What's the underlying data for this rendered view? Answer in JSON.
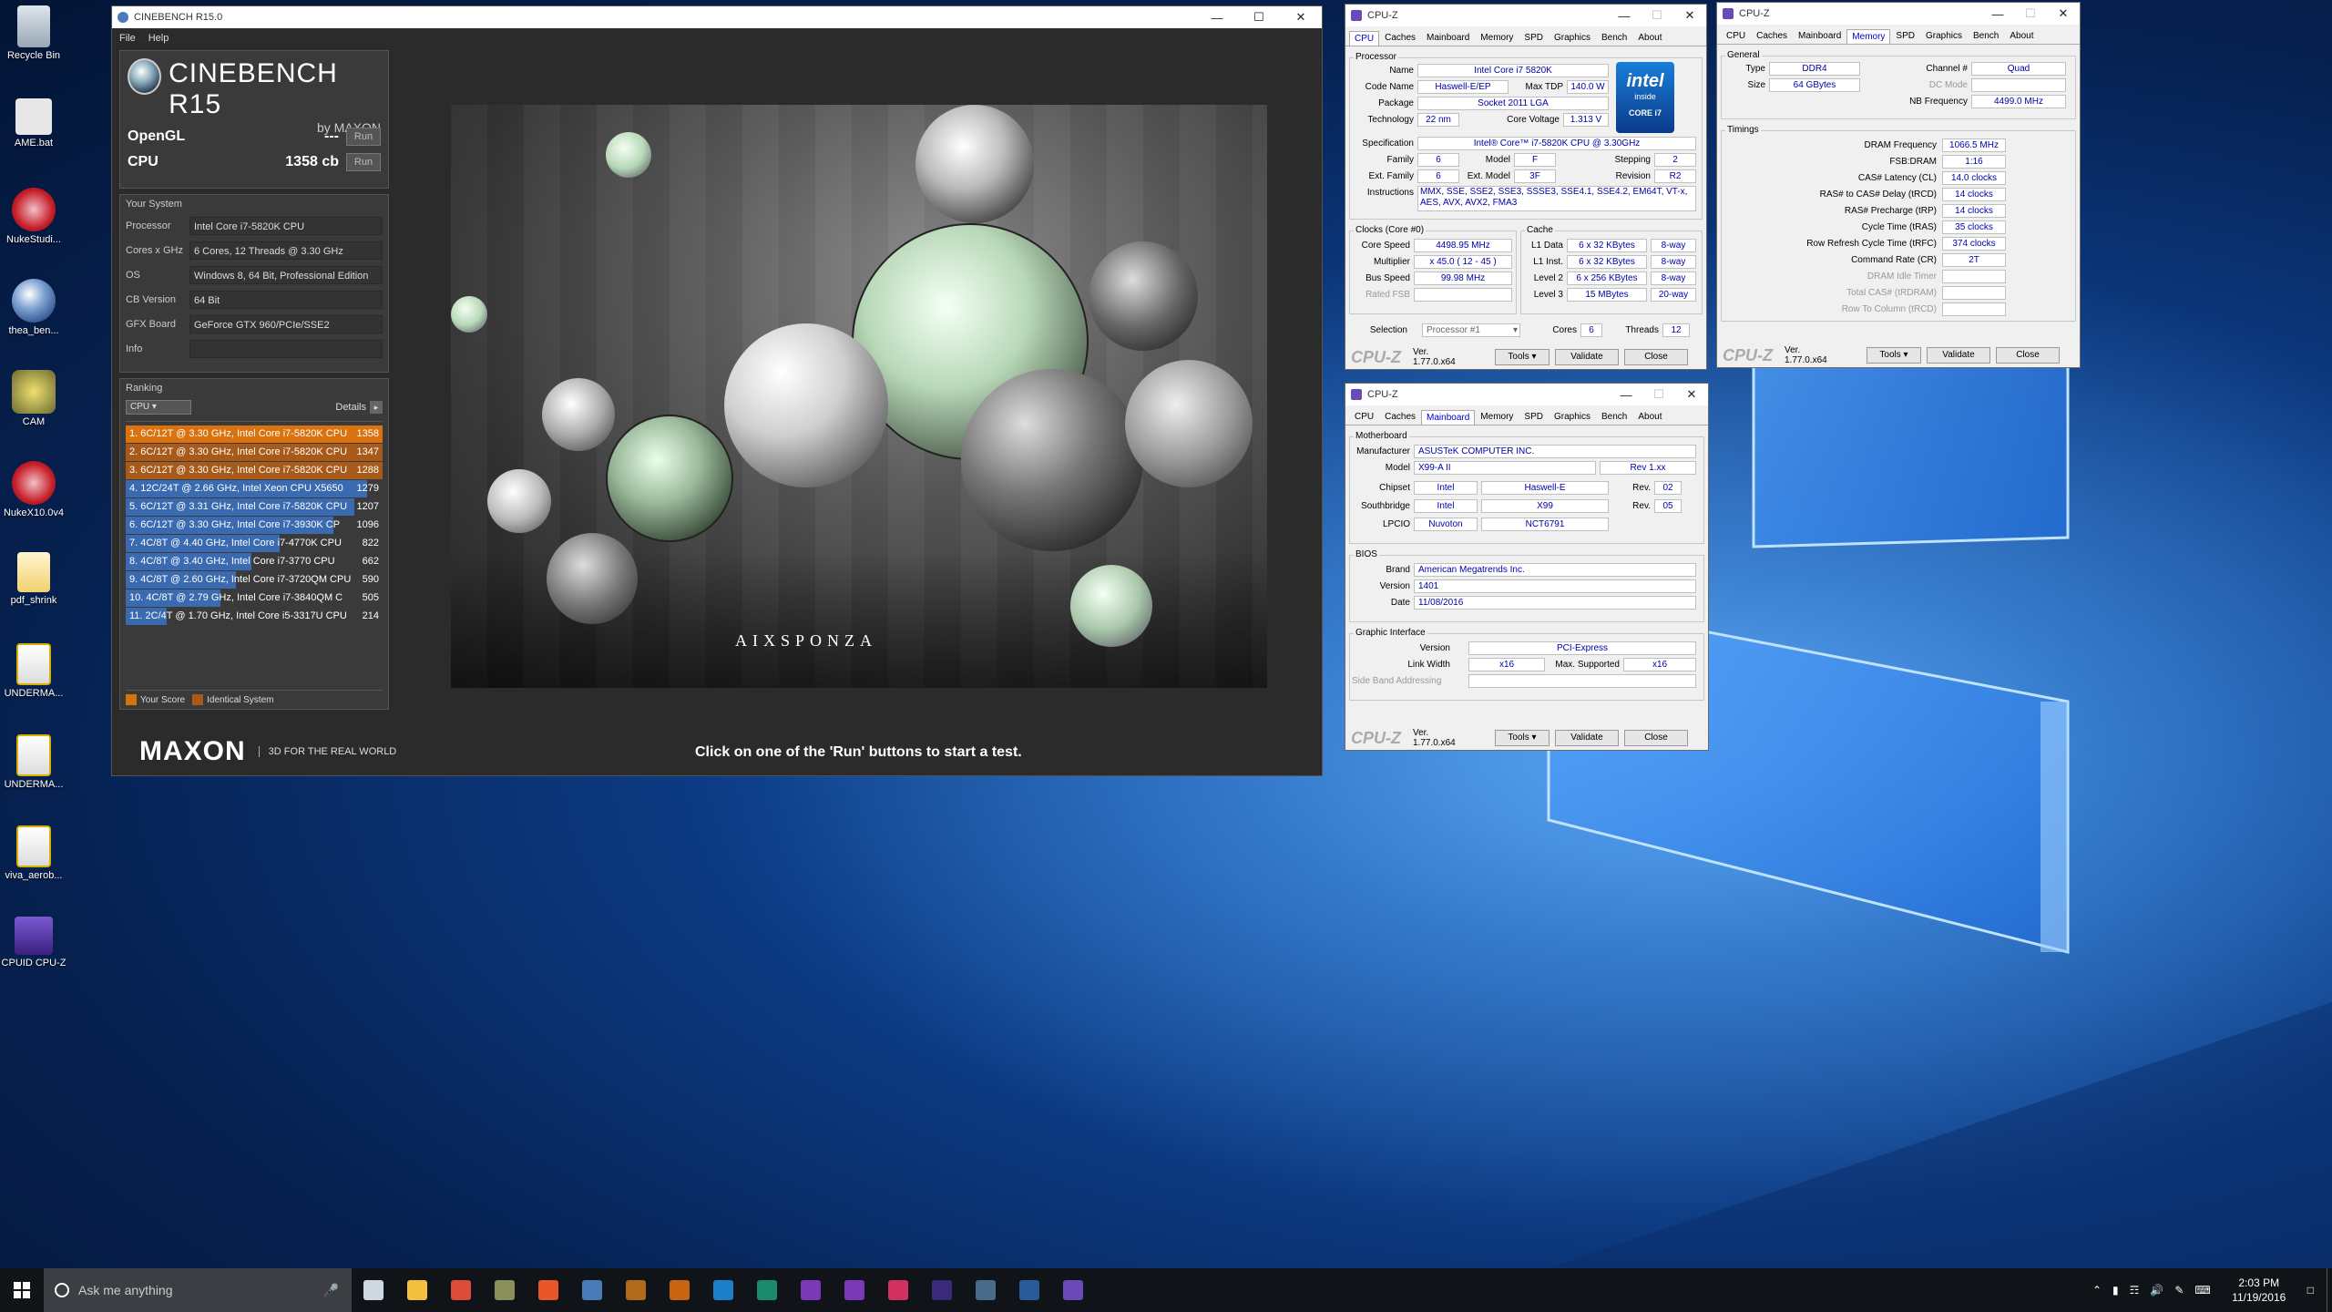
{
  "desktop": {
    "icons": [
      {
        "label": "Recycle Bin",
        "icon": "recycle-bin-icon"
      },
      {
        "label": "AME.bat",
        "icon": "batch-file-icon"
      },
      {
        "label": "NukeStudi...",
        "icon": "nuke-icon"
      },
      {
        "label": "thea_ben...",
        "icon": "cinema4d-icon"
      },
      {
        "label": "CAM",
        "icon": "cam-icon"
      },
      {
        "label": "NukeX10.0v4",
        "icon": "nuke-icon"
      },
      {
        "label": "pdf_shrink",
        "icon": "folder-icon"
      },
      {
        "label": "UNDERMA...",
        "icon": "pdf-icon"
      },
      {
        "label": "UNDERMA...",
        "icon": "pdf-icon"
      },
      {
        "label": "viva_aerob...",
        "icon": "pdf-icon"
      },
      {
        "label": "CPUID CPU-Z",
        "icon": "cpuz-icon"
      }
    ]
  },
  "cinebench": {
    "title": "CINEBENCH R15.0",
    "menu": [
      "File",
      "Help"
    ],
    "logo_title": "CINEBENCH R15",
    "logo_sub": "by MAXON",
    "opengl_label": "OpenGL",
    "opengl_value": "---",
    "cpu_label": "CPU",
    "cpu_value": "1358 cb",
    "run_label": "Run",
    "system_header": "Your System",
    "system": [
      {
        "k": "Processor",
        "v": "Intel Core i7-5820K CPU"
      },
      {
        "k": "Cores x GHz",
        "v": "6 Cores, 12 Threads @ 3.30 GHz"
      },
      {
        "k": "OS",
        "v": "Windows 8, 64 Bit, Professional Edition"
      },
      {
        "k": "CB Version",
        "v": "64 Bit"
      },
      {
        "k": "GFX Board",
        "v": "GeForce GTX 960/PCIe/SSE2"
      },
      {
        "k": "Info",
        "v": ""
      }
    ],
    "ranking_header": "Ranking",
    "ranking_select": "CPU",
    "details_label": "Details",
    "ranking": [
      {
        "label": "1. 6C/12T @ 3.30 GHz, Intel Core i7-5820K CPU",
        "value": "1358",
        "color": "#d9720f",
        "fill": 1.0
      },
      {
        "label": "2. 6C/12T @ 3.30 GHz, Intel Core i7-5820K CPU",
        "value": "1347",
        "color": "#a85a1a",
        "fill": 1.0
      },
      {
        "label": "3. 6C/12T @ 3.30 GHz, Intel Core i7-5820K CPU",
        "value": "1288",
        "color": "#a85a1a",
        "fill": 1.0
      },
      {
        "label": "4. 12C/24T @ 2.66 GHz, Intel Xeon CPU X5650",
        "value": "1279",
        "color": "#3a6ab0",
        "fill": 0.94
      },
      {
        "label": "5. 6C/12T @ 3.31 GHz, Intel Core i7-5820K CPU",
        "value": "1207",
        "color": "#3a6ab0",
        "fill": 0.89
      },
      {
        "label": "6. 6C/12T @ 3.30 GHz, Intel Core i7-3930K CP",
        "value": "1096",
        "color": "#3a6ab0",
        "fill": 0.81
      },
      {
        "label": "7. 4C/8T @ 4.40 GHz, Intel Core i7-4770K CPU",
        "value": "822",
        "color": "#3a6ab0",
        "fill": 0.6
      },
      {
        "label": "8. 4C/8T @ 3.40 GHz, Intel Core i7-3770 CPU",
        "value": "662",
        "color": "#3a6ab0",
        "fill": 0.49
      },
      {
        "label": "9. 4C/8T @ 2.60 GHz, Intel Core i7-3720QM CPU",
        "value": "590",
        "color": "#3a6ab0",
        "fill": 0.43
      },
      {
        "label": "10. 4C/8T @ 2.79 GHz, Intel Core i7-3840QM C",
        "value": "505",
        "color": "#3a6ab0",
        "fill": 0.37
      },
      {
        "label": "11. 2C/4T @ 1.70 GHz, Intel Core i5-3317U CPU",
        "value": "214",
        "color": "#3a6ab0",
        "fill": 0.16
      }
    ],
    "legend_your": "Your Score",
    "legend_identical": "Identical System",
    "footer_brand": "MAXON",
    "footer_tag": "3D FOR THE REAL WORLD",
    "footer_msg": "Click on one of the 'Run' buttons to start a test.",
    "render_credit": "AIXSPONZA"
  },
  "cpuz_common": {
    "title": "CPU-Z",
    "tabs": [
      "CPU",
      "Caches",
      "Mainboard",
      "Memory",
      "SPD",
      "Graphics",
      "Bench",
      "About"
    ],
    "logo": "CPU-Z",
    "version": "Ver. 1.77.0.x64",
    "tools": "Tools",
    "validate": "Validate",
    "close": "Close"
  },
  "cpuz_cpu": {
    "processor_group": "Processor",
    "name_l": "Name",
    "name": "Intel Core i7 5820K",
    "code_l": "Code Name",
    "code": "Haswell-E/EP",
    "tdp_l": "Max TDP",
    "tdp": "140.0 W",
    "pkg_l": "Package",
    "pkg": "Socket 2011 LGA",
    "tech_l": "Technology",
    "tech": "22 nm",
    "cv_l": "Core Voltage",
    "cv": "1.313 V",
    "spec_l": "Specification",
    "spec": "Intel® Core™ i7-5820K CPU @ 3.30GHz",
    "fam_l": "Family",
    "fam": "6",
    "model_l": "Model",
    "model": "F",
    "step_l": "Stepping",
    "step": "2",
    "efam_l": "Ext. Family",
    "efam": "6",
    "emodel_l": "Ext. Model",
    "emodel": "3F",
    "rev_l": "Revision",
    "rev": "R2",
    "inst_l": "Instructions",
    "inst": "MMX, SSE, SSE2, SSE3, SSSE3, SSE4.1, SSE4.2, EM64T, VT-x, AES, AVX, AVX2, FMA3",
    "clocks_group": "Clocks (Core #0)",
    "cs_l": "Core Speed",
    "cs": "4498.95 MHz",
    "mul_l": "Multiplier",
    "mul": "x 45.0 ( 12 - 45 )",
    "bus_l": "Bus Speed",
    "bus": "99.98 MHz",
    "fsb_l": "Rated FSB",
    "cache_group": "Cache",
    "l1d_l": "L1 Data",
    "l1d": "6 x 32 KBytes",
    "l1d_w": "8-way",
    "l1i_l": "L1 Inst.",
    "l1i": "6 x 32 KBytes",
    "l1i_w": "8-way",
    "l2_l": "Level 2",
    "l2": "6 x 256 KBytes",
    "l2_w": "8-way",
    "l3_l": "Level 3",
    "l3": "15 MBytes",
    "l3_w": "20-way",
    "sel_l": "Selection",
    "sel": "Processor #1",
    "cores_l": "Cores",
    "cores": "6",
    "threads_l": "Threads",
    "threads": "12",
    "intel_logo": "intel",
    "intel_inside": "inside",
    "intel_core": "CORE i7"
  },
  "cpuz_mem": {
    "general_group": "General",
    "type_l": "Type",
    "type": "DDR4",
    "chan_l": "Channel #",
    "chan": "Quad",
    "size_l": "Size",
    "size": "64 GBytes",
    "dc_l": "DC Mode",
    "nb_l": "NB Frequency",
    "nb": "4499.0 MHz",
    "timings_group": "Timings",
    "timings": [
      {
        "k": "DRAM Frequency",
        "v": "1066.5 MHz"
      },
      {
        "k": "FSB:DRAM",
        "v": "1:16"
      },
      {
        "k": "CAS# Latency (CL)",
        "v": "14.0 clocks"
      },
      {
        "k": "RAS# to CAS# Delay (tRCD)",
        "v": "14 clocks"
      },
      {
        "k": "RAS# Precharge (tRP)",
        "v": "14 clocks"
      },
      {
        "k": "Cycle Time (tRAS)",
        "v": "35 clocks"
      },
      {
        "k": "Row Refresh Cycle Time (tRFC)",
        "v": "374 clocks"
      },
      {
        "k": "Command Rate (CR)",
        "v": "2T"
      },
      {
        "k": "DRAM Idle Timer",
        "v": "",
        "grey": true
      },
      {
        "k": "Total CAS# (tRDRAM)",
        "v": "",
        "grey": true
      },
      {
        "k": "Row To Column (tRCD)",
        "v": "",
        "grey": true
      }
    ]
  },
  "cpuz_mb": {
    "mb_group": "Motherboard",
    "man_l": "Manufacturer",
    "man": "ASUSTeK COMPUTER INC.",
    "model_l": "Model",
    "model": "X99-A II",
    "rev": "Rev 1.xx",
    "chip_l": "Chipset",
    "chip1": "Intel",
    "chip2": "Haswell-E",
    "chip_rev_l": "Rev.",
    "chip_rev": "02",
    "sb_l": "Southbridge",
    "sb1": "Intel",
    "sb2": "X99",
    "sb_rev_l": "Rev.",
    "sb_rev": "05",
    "lpc_l": "LPCIO",
    "lpc1": "Nuvoton",
    "lpc2": "NCT6791",
    "bios_group": "BIOS",
    "brand_l": "Brand",
    "brand": "American Megatrends Inc.",
    "ver_l": "Version",
    "ver": "1401",
    "date_l": "Date",
    "date": "11/08/2016",
    "gi_group": "Graphic Interface",
    "giv_l": "Version",
    "giv": "PCI-Express",
    "lw_l": "Link Width",
    "lw": "x16",
    "ms_l": "Max. Supported",
    "ms": "x16",
    "sba_l": "Side Band Addressing"
  },
  "taskbar": {
    "search_placeholder": "Ask me anything",
    "time": "2:03 PM",
    "date": "11/19/2016",
    "apps": [
      {
        "name": "task-view-icon",
        "color": "#cfd8e0"
      },
      {
        "name": "file-explorer-icon",
        "color": "#f3c03e"
      },
      {
        "name": "chrome-icon",
        "color": "#dd4b39"
      },
      {
        "name": "cam-app-icon",
        "color": "#8a8f5a"
      },
      {
        "name": "resolve-icon",
        "color": "#e8562a"
      },
      {
        "name": "cinebench-app-icon",
        "color": "#4a7ab8"
      },
      {
        "name": "bridge-icon",
        "color": "#b06a1a"
      },
      {
        "name": "illustrator-icon",
        "color": "#c86410"
      },
      {
        "name": "photoshop-icon",
        "color": "#1c7fc8"
      },
      {
        "name": "audition-icon",
        "color": "#1a8a6a"
      },
      {
        "name": "premiere-icon",
        "color": "#7a3ab8"
      },
      {
        "name": "after-effects-icon",
        "color": "#7a3ab8"
      },
      {
        "name": "davinci-icon",
        "color": "#d23060"
      },
      {
        "name": "media-encoder-icon",
        "color": "#3a2a7a"
      },
      {
        "name": "explorer-icon",
        "color": "#4a6a8a"
      },
      {
        "name": "cinebench-running-icon",
        "color": "#2a5a9a"
      },
      {
        "name": "cpuz-running-icon",
        "color": "#6a4ab8"
      }
    ]
  }
}
